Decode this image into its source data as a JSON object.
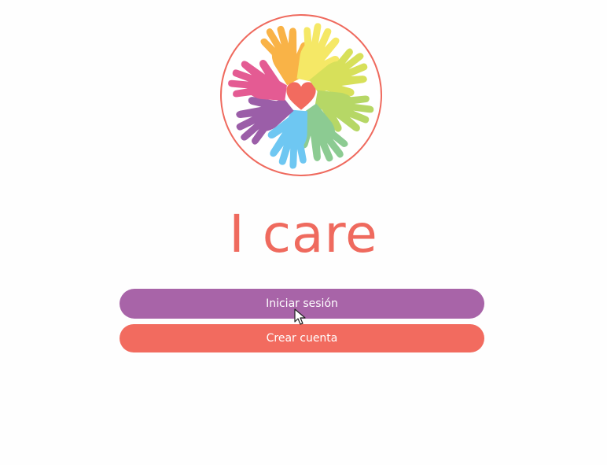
{
  "app": {
    "title": "I care"
  },
  "buttons": {
    "login_label": "Iniciar sesión",
    "register_label": "Crear cuenta"
  },
  "colors": {
    "accent": "#ef6a5e",
    "login_button": "#a864a8",
    "register_button": "#f26b5f"
  },
  "logo": {
    "icon": "hands-heart-logo"
  }
}
